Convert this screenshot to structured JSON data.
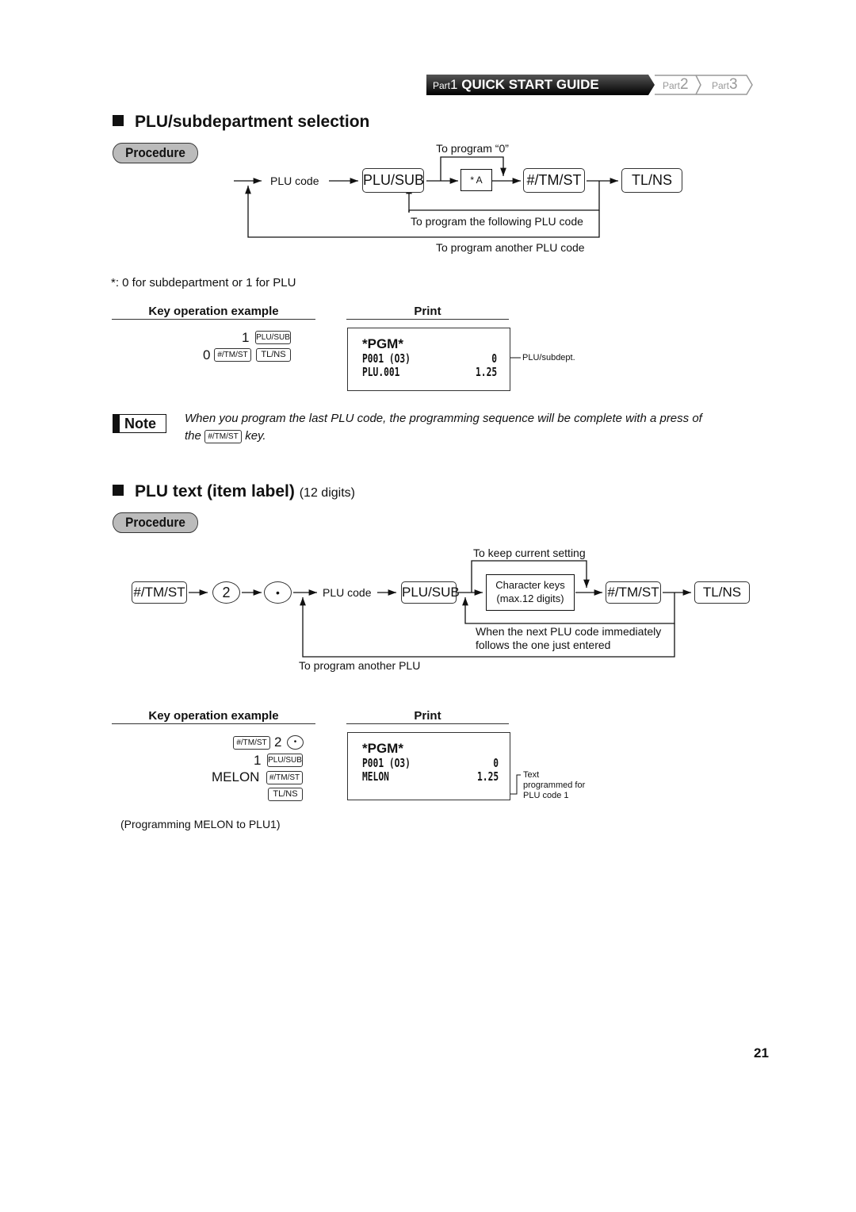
{
  "header": {
    "part1_prefix": "Part",
    "part1_num": "1",
    "part1_title": "QUICK START GUIDE",
    "part2_prefix": "Part",
    "part2_num": "2",
    "part3_prefix": "Part",
    "part3_num": "3"
  },
  "section1": {
    "title": "PLU/subdepartment selection",
    "procedure_label": "Procedure",
    "flow": {
      "plu_code": "PLU code",
      "key_plusub": "PLU/SUB",
      "box_a": "* A",
      "key_tmst": "#/TM/ST",
      "key_tlns": "TL/NS",
      "to_program_zero": "To program “0”",
      "to_program_following": "To program the following PLU code",
      "to_program_another": "To program another PLU code"
    },
    "footnote": "*: 0 for subdepartment or 1 for PLU",
    "example_header": "Key operation example",
    "print_header": "Print",
    "example": {
      "row1_num": "1",
      "row1_key": "PLU/SUB",
      "row2_num": "0",
      "row2_key1": "#/TM/ST",
      "row2_key2": "TL/NS"
    },
    "receipt": {
      "line1": "*PGM*",
      "line2_left": "P001  (O3)",
      "line2_right": "0",
      "line3_left": "PLU.001",
      "line3_right": "1.25"
    },
    "receipt_callout": "PLU/subdept."
  },
  "note": {
    "label": "Note",
    "text_before": "When you program the last PLU code, the programming sequence will be complete with a press of",
    "text_the": "the",
    "key": "#/TM/ST",
    "text_after": "key."
  },
  "section2": {
    "title": "PLU text (item label)",
    "title_suffix": "(12 digits)",
    "procedure_label": "Procedure",
    "flow": {
      "key_tmst_start": "#/TM/ST",
      "key_2": "2",
      "key_dot": "•",
      "plu_code": "PLU code",
      "key_plusub": "PLU/SUB",
      "char_keys_line1": "Character keys",
      "char_keys_line2": "(max.12 digits)",
      "key_tmst": "#/TM/ST",
      "key_tlns": "TL/NS",
      "to_keep_current": "To keep current setting",
      "when_next_line1": "When the next PLU code immediately",
      "when_next_line2": "follows the one just entered",
      "to_program_another": "To program another PLU"
    },
    "example_header": "Key operation example",
    "print_header": "Print",
    "example": {
      "row1_key": "#/TM/ST",
      "row1_num": "2",
      "row1_circle": "•",
      "row2_num": "1",
      "row2_key": "PLU/SUB",
      "row3_text": "MELON",
      "row3_key": "#/TM/ST",
      "row4_key": "TL/NS"
    },
    "receipt": {
      "line1": "*PGM*",
      "line2_left": "P001  (O3)",
      "line2_right": "0",
      "line3_left": "MELON",
      "line3_right": "1.25"
    },
    "receipt_callout_line1": "Text",
    "receipt_callout_line2": "programmed for",
    "receipt_callout_line3": "PLU code 1",
    "caption": "(Programming MELON to PLU1)"
  },
  "page_number": "21"
}
